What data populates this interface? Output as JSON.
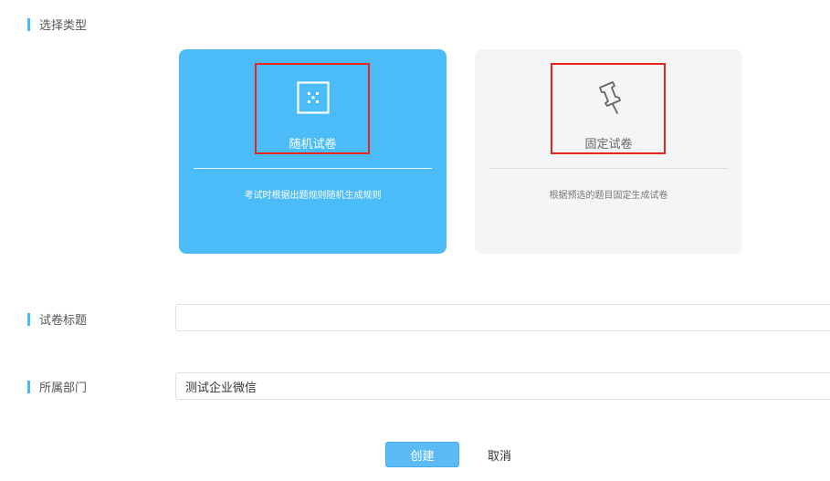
{
  "section_type": {
    "label": "选择类型"
  },
  "cards": {
    "random": {
      "icon": "dice-icon",
      "title": "随机试卷",
      "description": "考试时根据出题规则随机生成规则",
      "color": "#4cbcf8"
    },
    "fixed": {
      "icon": "pin-icon",
      "title": "固定试卷",
      "description": "根据预选的题目固定生成试卷",
      "color": "#f4f5f7"
    }
  },
  "form": {
    "title_field": {
      "label": "试卷标题",
      "value": "",
      "placeholder": ""
    },
    "department_field": {
      "label": "所属部门",
      "value": "测试企业微信"
    }
  },
  "actions": {
    "create_label": "创建",
    "cancel_label": "取消"
  },
  "colors": {
    "accent": "#4db8f5",
    "highlight_border": "#e8241c"
  }
}
